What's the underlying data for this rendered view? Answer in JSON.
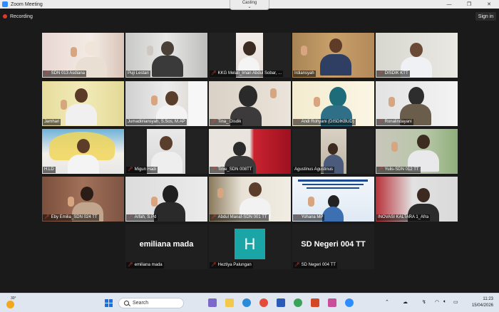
{
  "window": {
    "title": "Zoom Meeting",
    "controls": [
      "—",
      "❐",
      "✕"
    ]
  },
  "casting": {
    "label": "Casting",
    "chevron": "⌄"
  },
  "header": {
    "recording_label": "Recording",
    "signin_label": "Sign in"
  },
  "participants": [
    "SDN 013 Asdiana",
    "Puji Lestari",
    "KKG Melati_Iman Abdul Sobar, ...",
    "Irdiansyah",
    "DISDIK KTT",
    "Jamhari",
    "Jumadiiriansyah, S.Sos, M.AP",
    "Tina_ Disdik",
    "Andi Rohyani (DISDIKBUD)",
    "Ronalindayani",
    "H.LD",
    "Migun Hadi",
    "Tinie_SDN 008TT",
    "Agustinus Agustinus",
    "Yulis-SDN 012 TT",
    "Eby Emilia_SDN 024 TT",
    "Arfah, S.Pd",
    "Abdul Manaf-SDN 001 TT",
    "Yohana MP",
    "INOVASI KALTARA 1_Afra",
    "emiliana mada",
    "Heztiya Palungan",
    "SD Negeri 004 TT"
  ],
  "video_off": {
    "emiliana": "emiliana mada",
    "heztiya_initial": "H",
    "sdn004": "SD Negeri 004 TT"
  },
  "taskbar": {
    "temperature": "30°",
    "search_label": "Search",
    "time": "11:23",
    "date": "15/04/2026"
  },
  "colors": {
    "accent": "#2d8cff",
    "active_speaker": "#d5d83b",
    "muted": "#e2483a",
    "recording": "#e0392b"
  }
}
